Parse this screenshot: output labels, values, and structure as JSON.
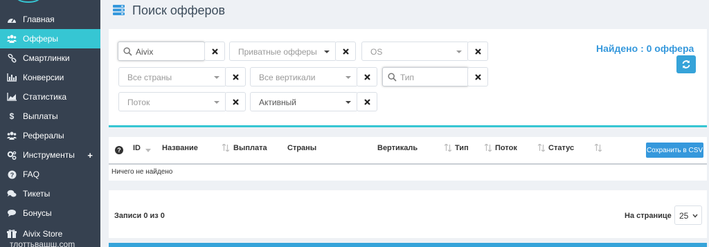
{
  "sidebar": {
    "items": [
      {
        "label": "Главная",
        "icon": "dashboard-icon"
      },
      {
        "label": "Офферы",
        "icon": "users-icon",
        "active": true
      },
      {
        "label": "Смартлинки",
        "icon": "link-icon"
      },
      {
        "label": "Конверсии",
        "icon": "bar-chart-icon"
      },
      {
        "label": "Статистика",
        "icon": "area-chart-icon"
      },
      {
        "label": "Выплаты",
        "icon": "dollar-icon"
      },
      {
        "label": "Рефералы",
        "icon": "users-icon"
      },
      {
        "label": "Инструменты",
        "icon": "gears-icon",
        "expand": "+"
      },
      {
        "label": "FAQ",
        "icon": "question-circle-icon"
      },
      {
        "label": "Тикеты",
        "icon": "comments-icon"
      },
      {
        "label": "Бонусы",
        "icon": "gift-icon"
      },
      {
        "label": "Aivix Store",
        "icon": "store-icon"
      }
    ],
    "bottom_text": "тлоттьвашш.com"
  },
  "header": {
    "title": "Поиск офферов"
  },
  "filters": {
    "search_value": "Aivix",
    "private_offers": "Приватные офферы",
    "os": "OS",
    "countries": "Все страны",
    "verticals": "Все вертикали",
    "type_placeholder": "Тип",
    "flow": "Поток",
    "status": "Активный"
  },
  "summary": {
    "found_label": "Найдено",
    "found_value": ": 0 оффера"
  },
  "table": {
    "columns": [
      "ID",
      "Название",
      "Выплата",
      "Страны",
      "Вертикаль",
      "Тип",
      "Поток",
      "Статус"
    ],
    "help_icon": "?",
    "csv_label": "Сохранить в CSV",
    "empty_text": "Ничего не найдено"
  },
  "footer": {
    "records_text": "Записи 0 из 0",
    "per_page_label": "На странице",
    "per_page_value": "25"
  },
  "colors": {
    "sidebar": "#364150",
    "accent": "#36c6d3",
    "link": "#3598dc"
  }
}
